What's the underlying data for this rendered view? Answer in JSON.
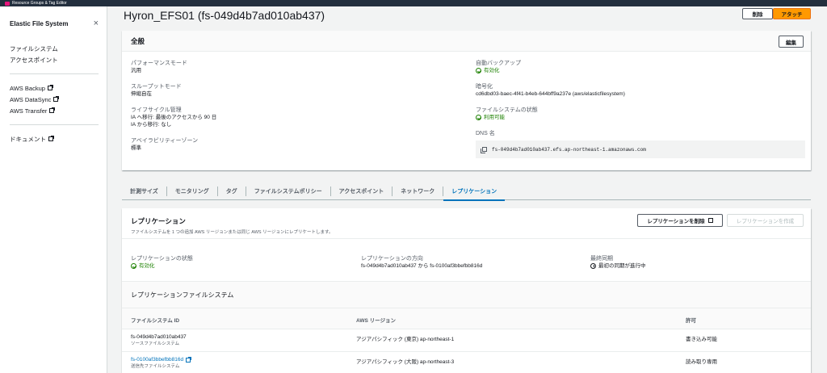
{
  "topbar": {
    "label": "Resource Groups & Tag Editor"
  },
  "sidebar": {
    "title": "Elastic File System",
    "group1": [
      "ファイルシステム",
      "アクセスポイント"
    ],
    "group2": [
      "AWS Backup",
      "AWS DataSync",
      "AWS Transfer"
    ],
    "group3": [
      "ドキュメント"
    ]
  },
  "header": {
    "title": "Hyron_EFS01 (fs-049d4b7ad010ab437)",
    "delete_label": "削除",
    "attach_label": "アタッチ"
  },
  "general": {
    "title": "全般",
    "edit_label": "編集",
    "performance_label": "パフォーマンスモード",
    "performance_value": "汎用",
    "throughput_label": "スループットモード",
    "throughput_value": "伸縮自在",
    "lifecycle_label": "ライフサイクル管理",
    "lifecycle_value1": "IA へ移行: 最後のアクセスから 90 日",
    "lifecycle_value2": "IA から移行: なし",
    "az_label": "アベイラビリティーゾーン",
    "az_value": "標準",
    "backup_label": "自動バックアップ",
    "backup_value": "有効化",
    "encryption_label": "暗号化",
    "encryption_value": "cd6dbd03-baec-4f41-b4eb-644bff9a237e (aws/elasticfilesystem)",
    "state_label": "ファイルシステムの状態",
    "state_value": "利用可能",
    "dns_label": "DNS 名",
    "dns_value": "fs-049d4b7ad010ab437.efs.ap-northeast-1.amazonaws.com"
  },
  "tabs": [
    "計測サイズ",
    "モニタリング",
    "タグ",
    "ファイルシステムポリシー",
    "アクセスポイント",
    "ネットワーク",
    "レプリケーション"
  ],
  "replication": {
    "title": "レプリケーション",
    "description": "ファイルシステムを 1 つの追加 AWS リージョンまたは同じ AWS リージョンにレプリケートします。",
    "delete_label": "レプリケーションを削除",
    "create_label": "レプリケーションを作成",
    "state_label": "レプリケーションの状態",
    "state_value": "有効化",
    "direction_label": "レプリケーションの方向",
    "direction_value": "fs-049d4b7ad010ab437 から fs-0100af3bbefbb816d",
    "last_sync_label": "最終同期",
    "last_sync_value": "最初の同期が進行中",
    "fs_title": "レプリケーションファイルシステム",
    "columns": [
      "ファイルシステム ID",
      "AWS リージョン",
      "許可"
    ],
    "rows": [
      {
        "id": "fs-049d4b7ad010ab437",
        "sub": "ソースファイルシステム",
        "region": "アジアパシフィック (東京) ap-northeast-1",
        "perm": "書き込み可能"
      },
      {
        "id": "fs-0100af3bbefbb816d",
        "sub": "送信先ファイルシステム",
        "region": "アジアパシフィック (大阪) ap-northeast-3",
        "perm": "読み取り専用"
      }
    ]
  },
  "colors": {
    "accent": "#0073bb",
    "success": "#1d8102",
    "primary_button": "#ff9900",
    "topbar": "#232f3e"
  }
}
